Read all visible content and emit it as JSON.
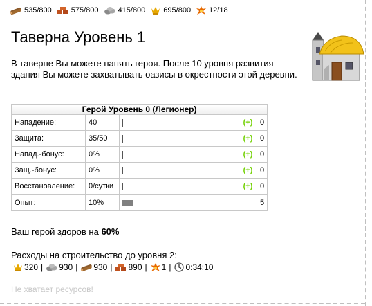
{
  "resources": [
    {
      "icon": "lumber-icon",
      "value": "535/800"
    },
    {
      "icon": "clay-icon",
      "value": "575/800"
    },
    {
      "icon": "iron-icon",
      "value": "415/800"
    },
    {
      "icon": "crop-icon",
      "value": "695/800"
    },
    {
      "icon": "crop-consumption-icon",
      "value": "12/18"
    }
  ],
  "page": {
    "title": "Таверна Уровень 1",
    "description": "В таверне Вы можете нанять героя. После 10 уровня развития здания Вы можете захватывать оазисы в окрестности этой деревни.",
    "building_icon": "tavern-building-icon"
  },
  "hero_table": {
    "header": "Герой Уровень 0 (Легионер)",
    "rows": [
      {
        "label": "Нападение:",
        "value": "40",
        "plus": "(+)",
        "points": "0",
        "bar_fraction": 0
      },
      {
        "label": "Защита:",
        "value": "35/50",
        "plus": "(+)",
        "points": "0",
        "bar_fraction": 0
      },
      {
        "label": "Напад.-бонус:",
        "value": "0%",
        "plus": "(+)",
        "points": "0",
        "bar_fraction": 0
      },
      {
        "label": "Защ.-бонус:",
        "value": "0%",
        "plus": "(+)",
        "points": "0",
        "bar_fraction": 0
      },
      {
        "label": "Восстановление:",
        "value": "0/сутки",
        "plus": "(+)",
        "points": "0",
        "bar_fraction": 0
      }
    ],
    "experience": {
      "label": "Опыт:",
      "value": "10%",
      "points": "5",
      "bar_fraction": 0.1
    }
  },
  "health": {
    "prefix": "Ваш герой здоров на ",
    "value": "60%"
  },
  "costs": {
    "title": "Расходы на строительство до уровня 2:",
    "items": [
      {
        "icon": "crop-icon",
        "value": "320"
      },
      {
        "icon": "iron-icon",
        "value": "930"
      },
      {
        "icon": "lumber-icon",
        "value": "930"
      },
      {
        "icon": "clay-icon",
        "value": "890"
      },
      {
        "icon": "crop-consumption-icon",
        "value": "1"
      },
      {
        "icon": "clock-icon",
        "value": "0:34:10"
      }
    ],
    "separator": "|"
  },
  "warning": "Не хватает ресурсов!",
  "colors": {
    "plus": "#71d000",
    "warning": "#c8c8c8",
    "border": "#c8c8c8",
    "exp_bar": "#808080"
  }
}
